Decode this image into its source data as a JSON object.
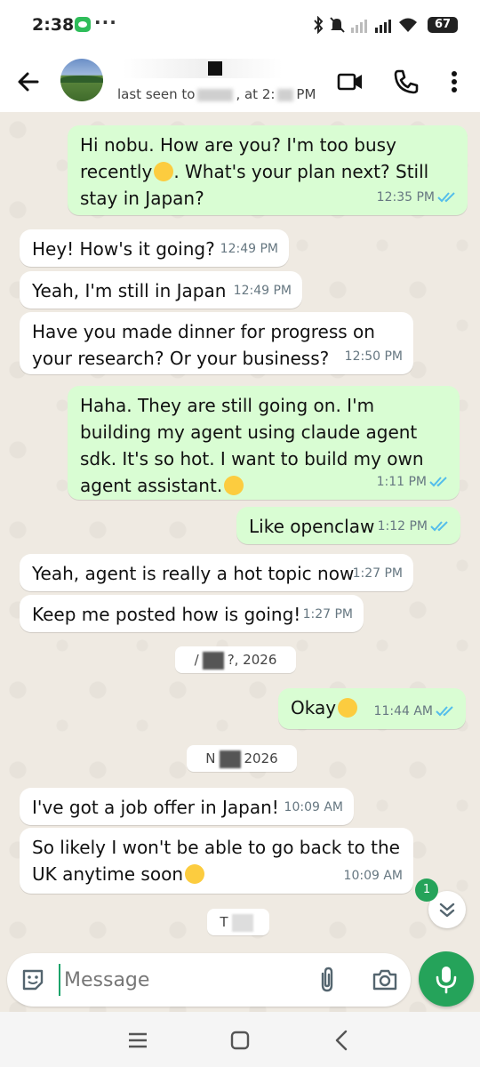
{
  "status_bar": {
    "time": "2:38",
    "battery": "67"
  },
  "header": {
    "name_partial": "",
    "last_seen_prefix": "last seen to",
    "last_seen_mid": ", at 2:",
    "last_seen_suffix": "PM"
  },
  "messages": [
    {
      "dir": "out",
      "text": "Hi nobu.  How are you? I'm too busy recently",
      "text2": ". What's your plan next? Still stay in Japan?",
      "emoji": "crying-face",
      "time": "12:35 PM",
      "read": true
    },
    {
      "dir": "in",
      "text": "Hey! How's it going?",
      "time": "12:49 PM"
    },
    {
      "dir": "in",
      "text": "Yeah, I'm still in Japan",
      "time": "12:49 PM"
    },
    {
      "dir": "in",
      "text": "Have you made dinner for progress on your research? Or your business?",
      "time": "12:50 PM"
    },
    {
      "dir": "out",
      "text": "Haha. They are still going on. I'm building my agent using claude agent sdk. It's so hot. I want to build my own agent assistant.",
      "emoji": "upside-down-face",
      "time": "1:11 PM",
      "read": true
    },
    {
      "dir": "out",
      "text": "Like openclaw",
      "time": "1:12 PM",
      "read": true
    },
    {
      "dir": "in",
      "text": "Yeah, agent is really a hot topic now",
      "time": "1:27 PM"
    },
    {
      "dir": "in",
      "text": "Keep me posted how is going!",
      "time": "1:27 PM"
    },
    {
      "dir": "out",
      "text": "Okay",
      "emoji": "sunglasses-face",
      "time": "11:44 AM",
      "read": true
    },
    {
      "dir": "in",
      "text": "I've got a job offer in Japan!",
      "time": "10:09 AM"
    },
    {
      "dir": "in",
      "text": "So likely I won't be able to go back to the UK anytime soon",
      "emoji": "grinning-sweat-face",
      "time": "10:09 AM"
    }
  ],
  "date_chips": [
    {
      "left": "/",
      "right": "?, 2026"
    },
    {
      "left": "N",
      "right": "2026"
    },
    {
      "left": "T",
      "right": ""
    }
  ],
  "unread_count": "1",
  "composer": {
    "placeholder": "Message"
  },
  "colors": {
    "outgoing": "#d9fdd3",
    "incoming": "#ffffff",
    "background": "#efeae2",
    "accent": "#25a35a",
    "read_tick": "#53bdeb"
  },
  "icons": [
    "back-arrow-icon",
    "video-call-icon",
    "phone-icon",
    "more-vert-icon",
    "sticker-icon",
    "attach-icon",
    "camera-icon",
    "mic-icon",
    "double-chevron-down-icon"
  ]
}
